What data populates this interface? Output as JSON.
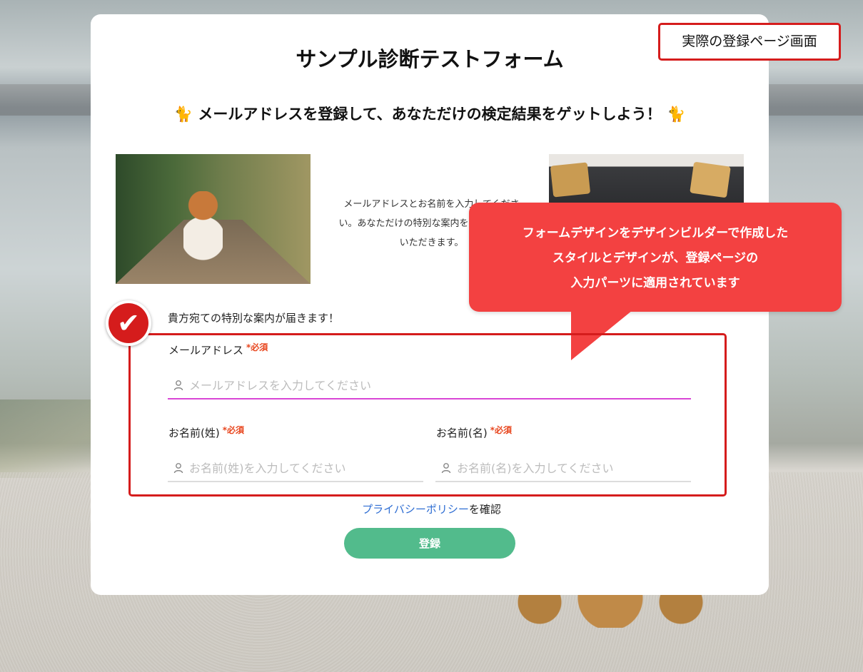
{
  "form": {
    "title": "サンプル診断テストフォーム",
    "subtitle": "🐈 メールアドレスを登録して、あなただけの検定結果をゲットしよう！ 🐈",
    "intro_text": "メールアドレスとお名前を入力してください。あなただけの特別な案内をお届けさせていただきます。",
    "notice": "貴方宛ての特別な案内が届きます！",
    "email": {
      "label": "メールアドレス",
      "required": "*必須",
      "placeholder": "メールアドレスを入力してください",
      "value": ""
    },
    "last_name": {
      "label": "お名前(姓)",
      "required": "*必須",
      "placeholder": "お名前(姓)を入力してください",
      "value": ""
    },
    "first_name": {
      "label": "お名前(名)",
      "required": "*必須",
      "placeholder": "お名前(名)を入力してください",
      "value": ""
    },
    "privacy_link": "プライバシーポリシー",
    "privacy_suffix": "を確認",
    "submit_label": "登録"
  },
  "annotations": {
    "screen_label": "実際の登録ページ画面",
    "callout_lines": [
      "フォームデザインをデザインビルダーで作成した",
      "スタイルとデザインが、登録ページの",
      "入力パーツに適用されています"
    ],
    "check_icon": "check-icon"
  },
  "colors": {
    "accent_red": "#d51c1c",
    "callout_red": "#f34141",
    "submit_green": "#52bb8c",
    "focus_underline": "#d946d6",
    "link_blue": "#2f6ed3",
    "required_orange": "#e8461e"
  }
}
